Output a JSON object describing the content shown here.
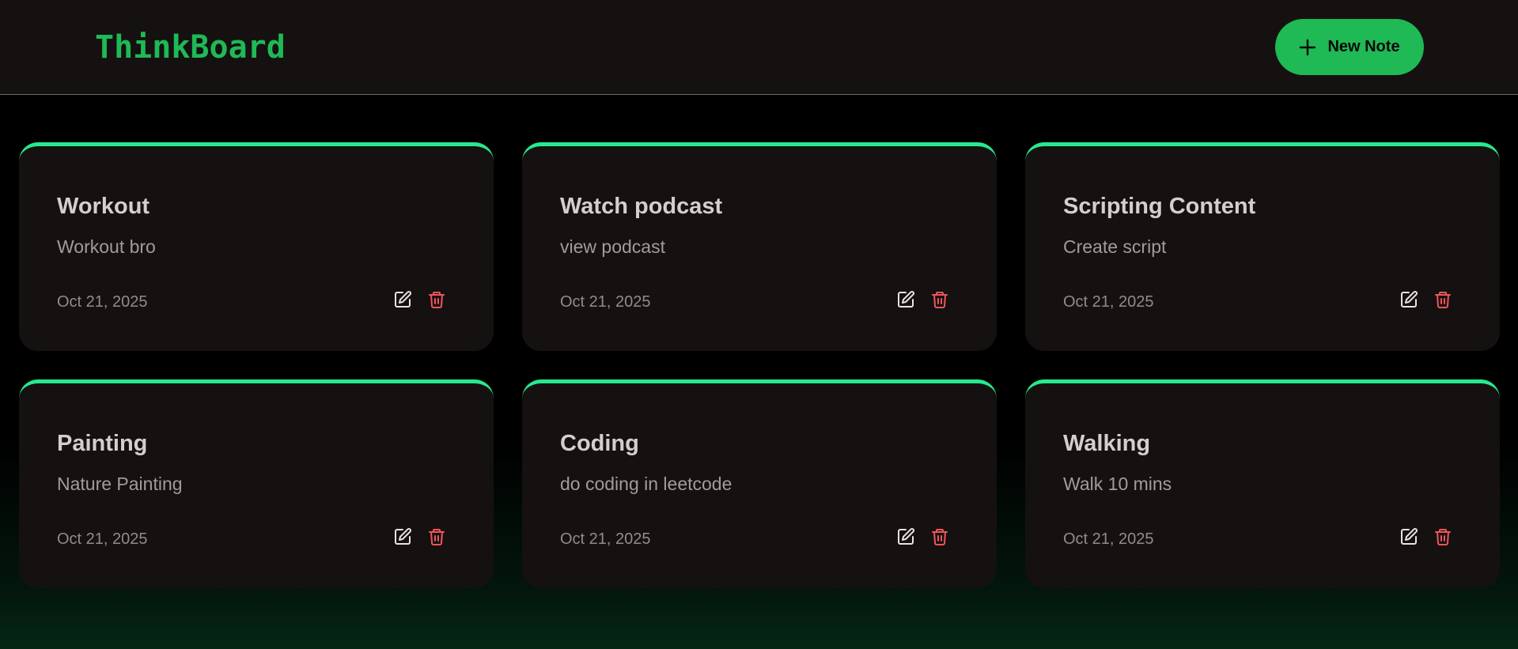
{
  "app": {
    "title": "ThinkBoard",
    "accent_color": "#1fb955",
    "card_top_border_color": "#27e98e",
    "delete_color": "#f2545b"
  },
  "header": {
    "new_note_label": "New Note",
    "new_note_icon": "plus-icon"
  },
  "notes": [
    {
      "title": "Workout",
      "content": "Workout bro",
      "date": "Oct 21, 2025",
      "edit_icon": "edit-icon",
      "delete_icon": "trash-icon"
    },
    {
      "title": "Watch podcast",
      "content": "view podcast",
      "date": "Oct 21, 2025",
      "edit_icon": "edit-icon",
      "delete_icon": "trash-icon"
    },
    {
      "title": "Scripting Content",
      "content": "Create script",
      "date": "Oct 21, 2025",
      "edit_icon": "edit-icon",
      "delete_icon": "trash-icon"
    },
    {
      "title": "Painting",
      "content": "Nature Painting",
      "date": "Oct 21, 2025",
      "edit_icon": "edit-icon",
      "delete_icon": "trash-icon"
    },
    {
      "title": "Coding",
      "content": "do coding in leetcode",
      "date": "Oct 21, 2025",
      "edit_icon": "edit-icon",
      "delete_icon": "trash-icon"
    },
    {
      "title": "Walking",
      "content": "Walk 10 mins",
      "date": "Oct 21, 2025",
      "edit_icon": "edit-icon",
      "delete_icon": "trash-icon"
    }
  ]
}
